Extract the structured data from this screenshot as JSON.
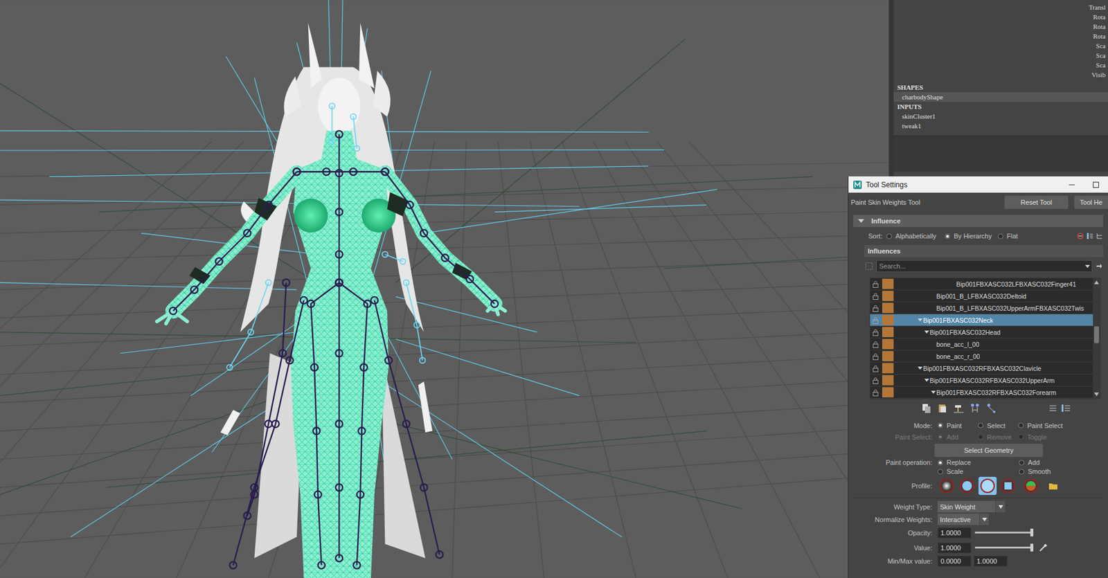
{
  "channel_box": {
    "attributes": [
      "Transl",
      "Rota",
      "Rota",
      "Rota",
      "Sca",
      "Sca",
      "Sca",
      "Visib"
    ],
    "shapes_header": "SHAPES",
    "shapes": [
      {
        "label": "charbodyShape",
        "selected": true
      }
    ],
    "inputs_header": "INPUTS",
    "inputs": [
      {
        "label": "skinCluster1",
        "selected": false
      },
      {
        "label": "tweak1",
        "selected": false
      }
    ]
  },
  "tool_window": {
    "title": "Tool Settings",
    "tool_name": "Paint Skin Weights Tool",
    "buttons": [
      "Reset Tool",
      "Tool He"
    ],
    "section": {
      "label": "Influence",
      "expanded": true
    },
    "sort": {
      "label": "Sort:",
      "options": [
        {
          "label": "Alphabetically",
          "selected": false
        },
        {
          "label": "By Hierarchy",
          "selected": true
        },
        {
          "label": "Flat",
          "selected": false
        }
      ]
    },
    "influences": {
      "header": "Influences",
      "search_placeholder": "Search...",
      "items": [
        {
          "name": "Bip001FBXASC032LFBXASC032Finger41",
          "depth": 5,
          "expanded": false,
          "selected": false,
          "color": "#b5763a"
        },
        {
          "name": "Bip001_B_LFBXASC032Deltoid",
          "depth": 2,
          "expanded": false,
          "selected": false,
          "color": "#b5763a"
        },
        {
          "name": "Bip001_B_LFBXASC032UpperArmFBXASC032Twis",
          "depth": 2,
          "expanded": false,
          "selected": false,
          "color": "#b5763a"
        },
        {
          "name": "Bip001FBXASC032Neck",
          "depth": 0,
          "expanded": true,
          "selected": true,
          "color": "#b5763a"
        },
        {
          "name": "Bip001FBXASC032Head",
          "depth": 1,
          "expanded": true,
          "selected": false,
          "color": "#b5763a"
        },
        {
          "name": "bone_acc_l_00",
          "depth": 2,
          "expanded": false,
          "selected": false,
          "color": "#b5763a"
        },
        {
          "name": "bone_acc_r_00",
          "depth": 2,
          "expanded": false,
          "selected": false,
          "color": "#b5763a"
        },
        {
          "name": "Bip001FBXASC032RFBXASC032Clavicle",
          "depth": 0,
          "expanded": true,
          "selected": false,
          "color": "#b5763a"
        },
        {
          "name": "Bip001FBXASC032RFBXASC032UpperArm",
          "depth": 1,
          "expanded": true,
          "selected": false,
          "color": "#b5763a"
        },
        {
          "name": "Bip001FBXASC032RFBXASC032Forearm",
          "depth": 2,
          "expanded": true,
          "selected": false,
          "color": "#b5763a"
        }
      ]
    },
    "mode": {
      "label": "Mode:",
      "options": [
        {
          "label": "Paint",
          "selected": true
        },
        {
          "label": "Select",
          "selected": false
        },
        {
          "label": "Paint Select",
          "selected": false
        }
      ]
    },
    "paint_select": {
      "label": "Paint Select:",
      "disabled": true,
      "options": [
        {
          "label": "Add",
          "selected": true
        },
        {
          "label": "Remove",
          "selected": false
        },
        {
          "label": "Toggle",
          "selected": false
        }
      ]
    },
    "select_geometry": "Select Geometry",
    "paint_operation": {
      "label": "Paint operation:",
      "options": [
        {
          "label": "Replace",
          "selected": true
        },
        {
          "label": "Add",
          "selected": false
        },
        {
          "label": "Scale",
          "selected": false
        },
        {
          "label": "Smooth",
          "selected": false
        }
      ]
    },
    "profile": {
      "label": "Profile:",
      "brushes": [
        {
          "kind": "gaussian",
          "selected": false
        },
        {
          "kind": "soft",
          "selected": false
        },
        {
          "kind": "solid",
          "selected": true
        },
        {
          "kind": "square",
          "selected": false
        }
      ]
    },
    "weight_type": {
      "label": "Weight Type:",
      "value": "Skin Weight"
    },
    "normalize_weights": {
      "label": "Normalize Weights:",
      "value": "Interactive"
    },
    "opacity": {
      "label": "Opacity:",
      "value": "1.0000",
      "level": 1
    },
    "value": {
      "label": "Value:",
      "value": "1.0000",
      "level": 1
    },
    "min_max": {
      "label": "Min/Max value:",
      "min": "0.0000",
      "max": "1.0000"
    }
  }
}
